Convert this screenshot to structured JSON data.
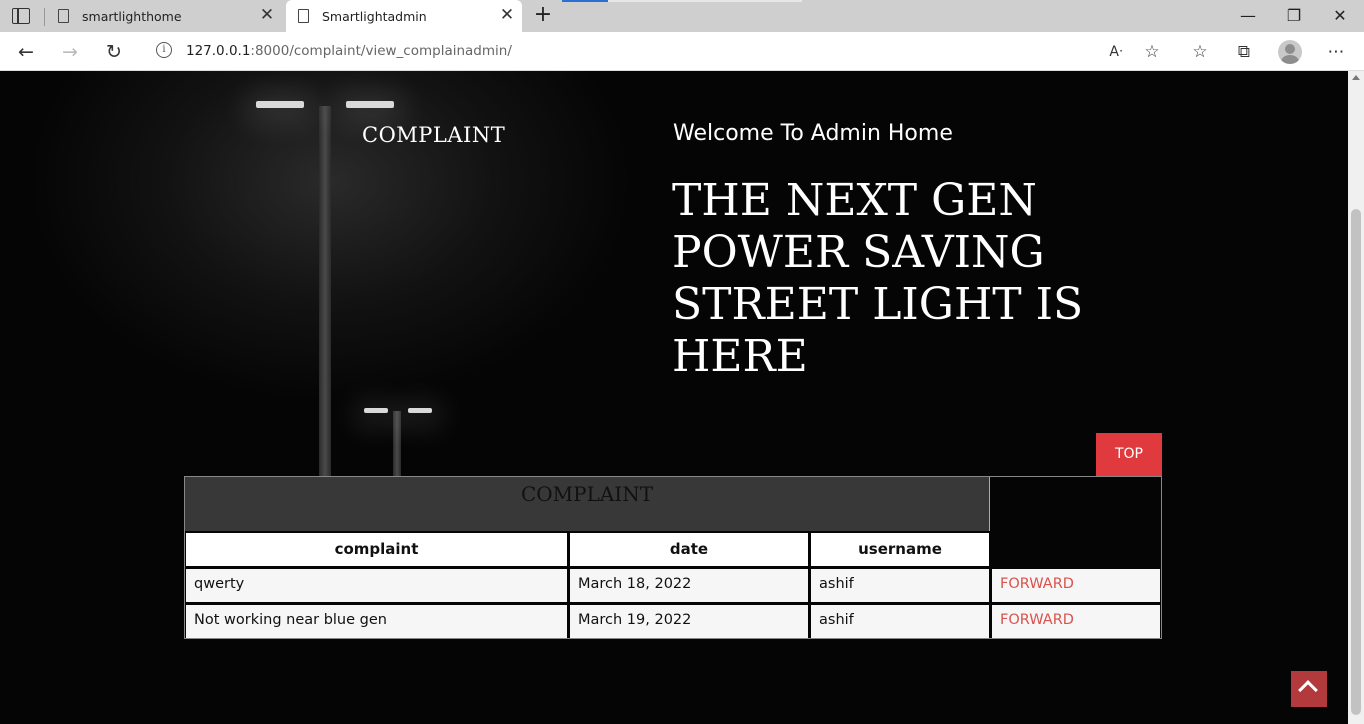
{
  "browser": {
    "tabs": [
      {
        "title": "smartlighthome",
        "active": false
      },
      {
        "title": "Smartlightadmin",
        "active": true
      }
    ],
    "url_host": "127.0.0.1",
    "url_rest": ":8000/complaint/view_complainadmin/"
  },
  "header": {
    "brand": "COMPLAINT",
    "welcome": "Welcome To Admin Home"
  },
  "hero": {
    "text": "THE NEXT GEN POWER SAVING STREET LIGHT IS HERE"
  },
  "top_button": "TOP",
  "table": {
    "caption": "COMPLAINT",
    "columns": [
      "complaint",
      "date",
      "username"
    ],
    "rows": [
      {
        "complaint": "qwerty",
        "date": "March 18, 2022",
        "username": "ashif",
        "action": "FORWARD"
      },
      {
        "complaint": "Not working near blue gen",
        "date": "March 19, 2022",
        "username": "ashif",
        "action": "FORWARD"
      }
    ]
  }
}
